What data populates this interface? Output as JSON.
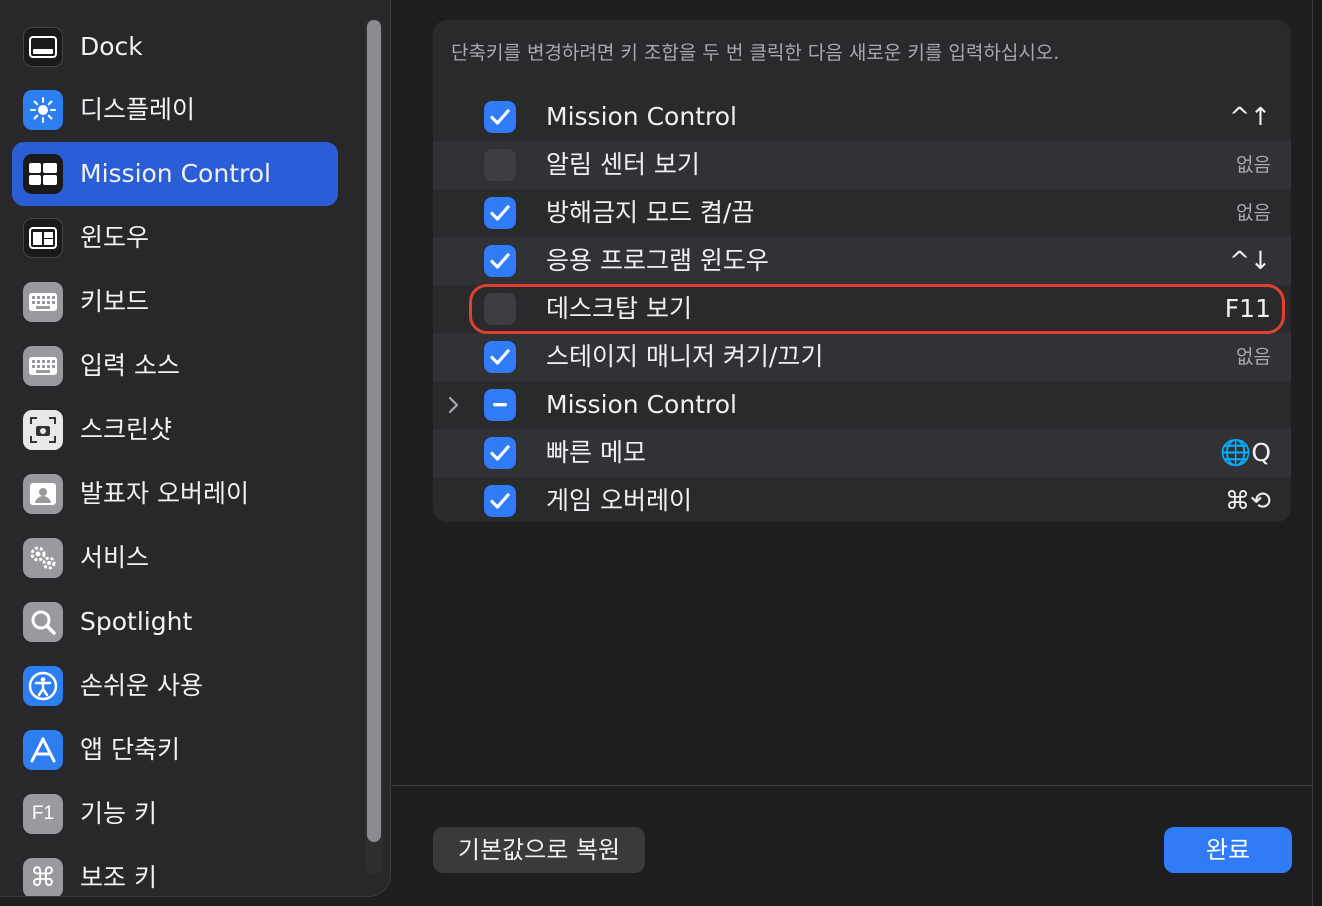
{
  "sidebar": {
    "items": [
      {
        "label": "Dock",
        "icon": "dock-icon",
        "color": "#1a1a1a"
      },
      {
        "label": "디스플레이",
        "icon": "display-icon",
        "color": "#2d7ef0"
      },
      {
        "label": "Mission Control",
        "icon": "mission-control-icon",
        "color": "#1a1a1a",
        "selected": true
      },
      {
        "label": "윈도우",
        "icon": "window-icon",
        "color": "#1a1a1a"
      },
      {
        "label": "키보드",
        "icon": "keyboard-icon",
        "color": "#9a9a9e"
      },
      {
        "label": "입력 소스",
        "icon": "input-source-icon",
        "color": "#9a9a9e"
      },
      {
        "label": "스크린샷",
        "icon": "screenshot-icon",
        "color": "#e8e8ea"
      },
      {
        "label": "발표자 오버레이",
        "icon": "presenter-overlay-icon",
        "color": "#9a9a9e"
      },
      {
        "label": "서비스",
        "icon": "services-icon",
        "color": "#9a9a9e"
      },
      {
        "label": "Spotlight",
        "icon": "spotlight-icon",
        "color": "#9a9a9e"
      },
      {
        "label": "손쉬운 사용",
        "icon": "accessibility-icon",
        "color": "#2d7ef0"
      },
      {
        "label": "앱 단축키",
        "icon": "app-shortcuts-icon",
        "color": "#2d7ef0"
      },
      {
        "label": "기능 키",
        "icon": "function-keys-icon",
        "color": "#9a9a9e"
      },
      {
        "label": "보조 키",
        "icon": "modifier-keys-icon",
        "color": "#9a9a9e"
      }
    ]
  },
  "main": {
    "hint": "단축키를 변경하려면 키 조합을 두 번 클릭한 다음 새로운 키를 입력하십시오.",
    "rows": [
      {
        "label": "Mission Control",
        "shortcut": "^↑",
        "state": "on"
      },
      {
        "label": "알림 센터 보기",
        "shortcut": "없음",
        "state": "off"
      },
      {
        "label": "방해금지 모드 켬/끔",
        "shortcut": "없음",
        "state": "on"
      },
      {
        "label": "응용 프로그램 윈도우",
        "shortcut": "^↓",
        "state": "on"
      },
      {
        "label": "데스크탑 보기",
        "shortcut": "F11",
        "state": "off"
      },
      {
        "label": "스테이지 매니저 켜기/끄기",
        "shortcut": "없음",
        "state": "on"
      },
      {
        "label": "Mission Control",
        "shortcut": "",
        "state": "mixed"
      },
      {
        "label": "빠른 메모",
        "shortcut": "🌐Q",
        "state": "on"
      },
      {
        "label": "게임 오버레이",
        "shortcut": "⌘⟲",
        "state": "on"
      }
    ]
  },
  "footer": {
    "restore_label": "기본값으로 복원",
    "done_label": "완료"
  },
  "colors": {
    "accent": "#2f7cf6",
    "selection": "#2b5ed6",
    "highlight": "#e0402f"
  }
}
